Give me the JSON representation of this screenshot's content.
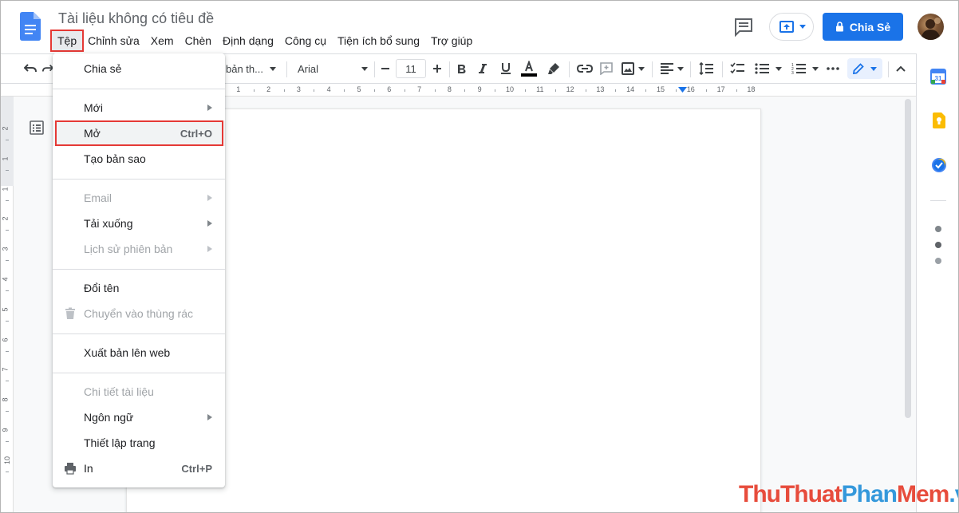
{
  "app": {
    "title": "Tài liệu không có tiêu đề"
  },
  "menubar": [
    {
      "label": "Tệp",
      "active": true
    },
    {
      "label": "Chỉnh sửa"
    },
    {
      "label": "Xem"
    },
    {
      "label": "Chèn"
    },
    {
      "label": "Định dạng"
    },
    {
      "label": "Công cụ"
    },
    {
      "label": "Tiện ích bổ sung"
    },
    {
      "label": "Trợ giúp"
    }
  ],
  "header": {
    "share_label": "Chia Sẻ",
    "share_color": "#1a73e8"
  },
  "toolbar": {
    "style_label": "bản th...",
    "font_label": "Arial",
    "font_size": "11"
  },
  "ruler": {
    "h_ticks": [
      "1",
      "2",
      "3",
      "4",
      "5",
      "6",
      "7",
      "8",
      "9",
      "10",
      "11",
      "12",
      "13",
      "14",
      "15",
      "16",
      "17",
      "18"
    ],
    "v_ticks": [
      "2",
      "1",
      "1",
      "2",
      "3",
      "4",
      "5",
      "6",
      "7",
      "8",
      "9",
      "10"
    ]
  },
  "file_menu": {
    "items": [
      {
        "label": "Chia sẻ"
      },
      {
        "label": "Mới",
        "submenu": true
      },
      {
        "label": "Mở",
        "shortcut": "Ctrl+O",
        "highlighted": true
      },
      {
        "label": "Tạo bản sao"
      },
      {
        "label": "Email",
        "submenu": true,
        "disabled": true
      },
      {
        "label": "Tải xuống",
        "submenu": true
      },
      {
        "label": "Lịch sử phiên bản",
        "submenu": true,
        "disabled": true
      },
      {
        "label": "Đổi tên"
      },
      {
        "label": "Chuyển vào thùng rác",
        "disabled": true,
        "icon": "trash-icon"
      },
      {
        "label": "Xuất bản lên web"
      },
      {
        "label": "Chi tiết tài liệu",
        "disabled": true
      },
      {
        "label": "Ngôn ngữ",
        "submenu": true
      },
      {
        "label": "Thiết lập trang"
      },
      {
        "label": "In",
        "shortcut": "Ctrl+P",
        "icon": "print-icon"
      }
    ]
  },
  "watermark": {
    "part1": "Thu",
    "part2": "Thuat",
    "part3": "Phan",
    "part4": "Mem",
    "part5": ".vn"
  },
  "colors": {
    "highlight_red": "#e53935",
    "brand_blue": "#4285f4"
  }
}
